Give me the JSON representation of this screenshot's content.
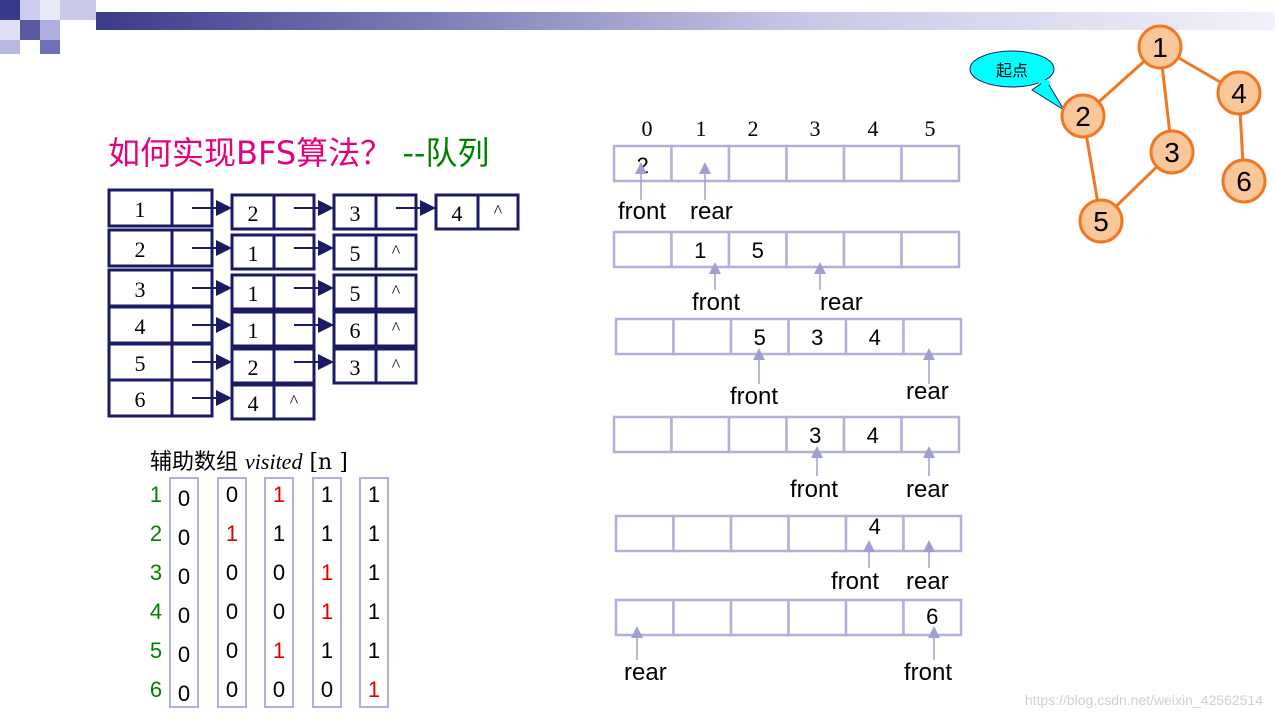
{
  "title": {
    "part1": "如何实现",
    "part2": "BFS算法？",
    "part3": "--队列"
  },
  "adjacency_list": {
    "heads": [
      "1",
      "2",
      "3",
      "4",
      "5",
      "6"
    ],
    "lists": [
      [
        "2",
        "3",
        "4"
      ],
      [
        "1",
        "5"
      ],
      [
        "1",
        "5"
      ],
      [
        "1",
        "6"
      ],
      [
        "2",
        "3"
      ],
      [
        "4"
      ]
    ],
    "null_symbol": "^"
  },
  "visited": {
    "label": "辅助数组",
    "label_var": "visited",
    "label_index": "[n ]",
    "row_labels": [
      "1",
      "2",
      "3",
      "4",
      "5",
      "6"
    ],
    "columns": [
      [
        "0",
        "0",
        "0",
        "0",
        "0",
        "0"
      ],
      [
        "0",
        "1",
        "0",
        "0",
        "0",
        "0"
      ],
      [
        "1",
        "1",
        "0",
        "0",
        "1",
        "0"
      ],
      [
        "1",
        "1",
        "1",
        "1",
        "1",
        "0"
      ],
      [
        "1",
        "1",
        "1",
        "1",
        "1",
        "1"
      ]
    ],
    "highlight_color": "#e00000"
  },
  "queue": {
    "indices": [
      "0",
      "1",
      "2",
      "3",
      "4",
      "5"
    ],
    "states": [
      {
        "cells": [
          "2",
          "",
          "",
          "",
          "",
          ""
        ],
        "front": "front",
        "rear": "rear"
      },
      {
        "cells": [
          "",
          "1",
          "5",
          "",
          "",
          ""
        ],
        "front": "front",
        "rear": "rear"
      },
      {
        "cells": [
          "",
          "",
          "5",
          "3",
          "4",
          ""
        ],
        "front": "front",
        "rear": "rear"
      },
      {
        "cells": [
          "",
          "",
          "",
          "3",
          "4",
          ""
        ],
        "front": "front",
        "rear": "rear"
      },
      {
        "cells": [
          "",
          "",
          "",
          "",
          "4",
          ""
        ],
        "front": "front",
        "rear": "rear"
      },
      {
        "cells": [
          "",
          "",
          "",
          "",
          "",
          "6"
        ],
        "front": "front",
        "rear": "rear"
      }
    ]
  },
  "graph": {
    "nodes": [
      "1",
      "2",
      "3",
      "4",
      "5",
      "6"
    ],
    "edges": [
      [
        "1",
        "2"
      ],
      [
        "1",
        "3"
      ],
      [
        "1",
        "4"
      ],
      [
        "2",
        "5"
      ],
      [
        "3",
        "5"
      ],
      [
        "4",
        "6"
      ]
    ],
    "start_label": "起点",
    "node_fill": "#f9c79a",
    "node_stroke": "#f07820",
    "callout_fill": "#00ffff"
  },
  "watermark": "https://blog.csdn.net/weixin_42562514",
  "colors": {
    "navy": "#1a1a66",
    "queue_border": "#b0b0d8",
    "arrow": "#a0a0d0"
  }
}
